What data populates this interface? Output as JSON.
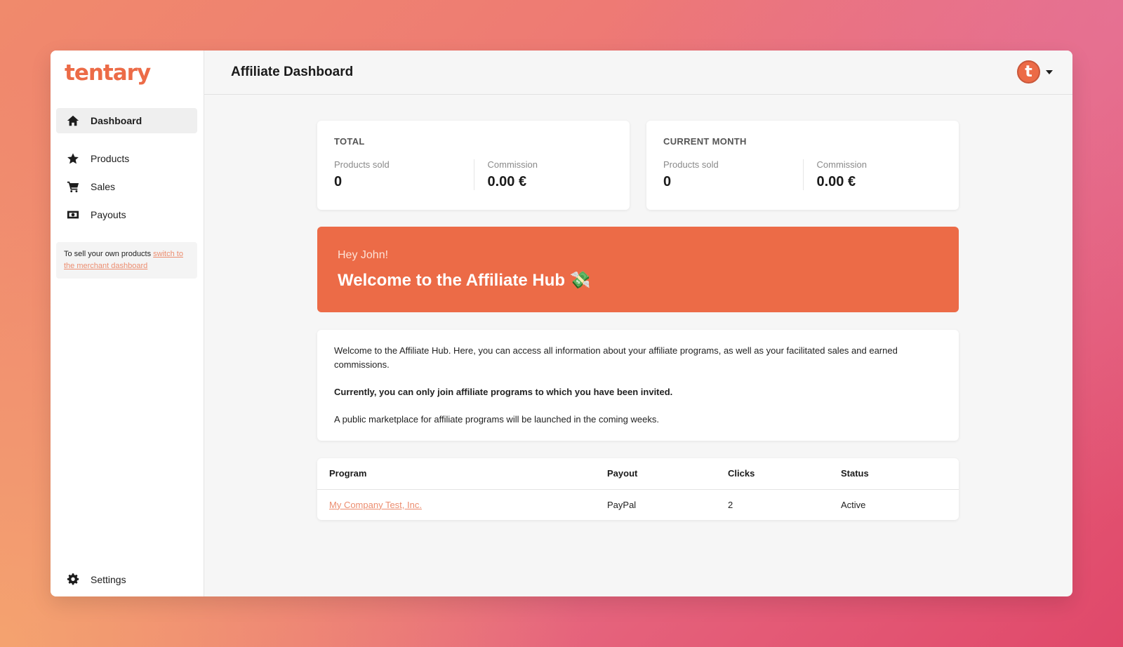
{
  "brand": {
    "logo_text": "tentary",
    "accent_color": "#ec6b47"
  },
  "sidebar": {
    "items": [
      {
        "label": "Dashboard",
        "icon": "home-icon",
        "active": true
      },
      {
        "label": "Products",
        "icon": "star-icon",
        "active": false
      },
      {
        "label": "Sales",
        "icon": "cart-icon",
        "active": false
      },
      {
        "label": "Payouts",
        "icon": "money-icon",
        "active": false
      }
    ],
    "switch_text": "To sell your own products ",
    "switch_link": "switch to the merchant dashboard",
    "settings_label": "Settings"
  },
  "header": {
    "title": "Affiliate Dashboard",
    "avatar_letter": "t"
  },
  "stats": {
    "total": {
      "title": "TOTAL",
      "products_label": "Products sold",
      "products_value": "0",
      "commission_label": "Commission",
      "commission_value": "0.00 €"
    },
    "month": {
      "title": "CURRENT MONTH",
      "products_label": "Products sold",
      "products_value": "0",
      "commission_label": "Commission",
      "commission_value": "0.00 €"
    }
  },
  "banner": {
    "greeting": "Hey John!",
    "title": "Welcome to the Affiliate Hub 💸"
  },
  "info": {
    "p1": "Welcome to the Affiliate Hub. Here, you can access all information about your affiliate programs, as well as your facilitated sales and earned commissions.",
    "p2": "Currently, you can only join affiliate programs to which you have been invited.",
    "p3": "A public marketplace for affiliate programs will be launched in the coming weeks."
  },
  "table": {
    "headers": [
      "Program",
      "Payout",
      "Clicks",
      "Status"
    ],
    "rows": [
      {
        "program": "My Company Test, Inc.",
        "payout": "PayPal",
        "clicks": "2",
        "status": "Active"
      }
    ]
  }
}
